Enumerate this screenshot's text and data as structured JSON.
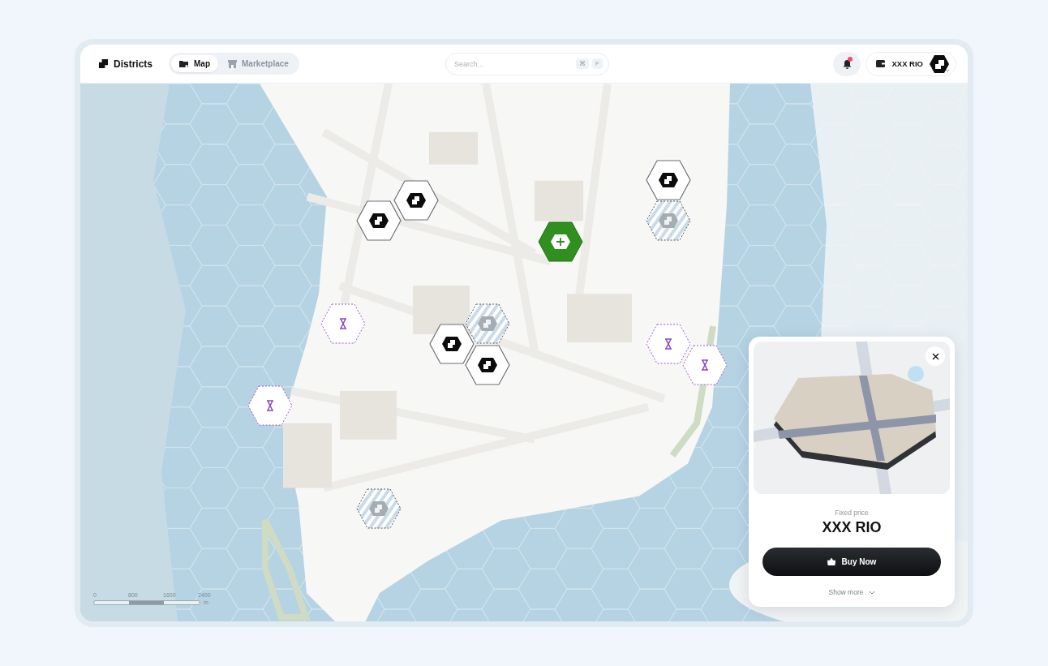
{
  "brand": {
    "name": "Districts"
  },
  "tabs": [
    {
      "label": "Map",
      "selected": true
    },
    {
      "label": "Marketplace",
      "selected": false
    }
  ],
  "search": {
    "placeholder": "Search...",
    "shortcut_keys": [
      "⌘",
      "F"
    ]
  },
  "notifications": {
    "unread": true
  },
  "wallet": {
    "label": "XXX RIO"
  },
  "markers": [
    {
      "kind": "owned"
    },
    {
      "kind": "owned"
    },
    {
      "kind": "owned"
    },
    {
      "kind": "owned"
    },
    {
      "kind": "owned"
    },
    {
      "kind": "listed"
    },
    {
      "kind": "listed"
    },
    {
      "kind": "listed"
    },
    {
      "kind": "pending"
    },
    {
      "kind": "pending"
    },
    {
      "kind": "pending"
    },
    {
      "kind": "pending"
    },
    {
      "kind": "selected"
    }
  ],
  "scale_bar": {
    "ticks": [
      "0",
      "800",
      "1600",
      "2400"
    ],
    "unit": "m"
  },
  "listing_card": {
    "price_label": "Fixed price",
    "price": "XXX RIO",
    "buy_button": "Buy Now",
    "show_more": "Show more"
  }
}
